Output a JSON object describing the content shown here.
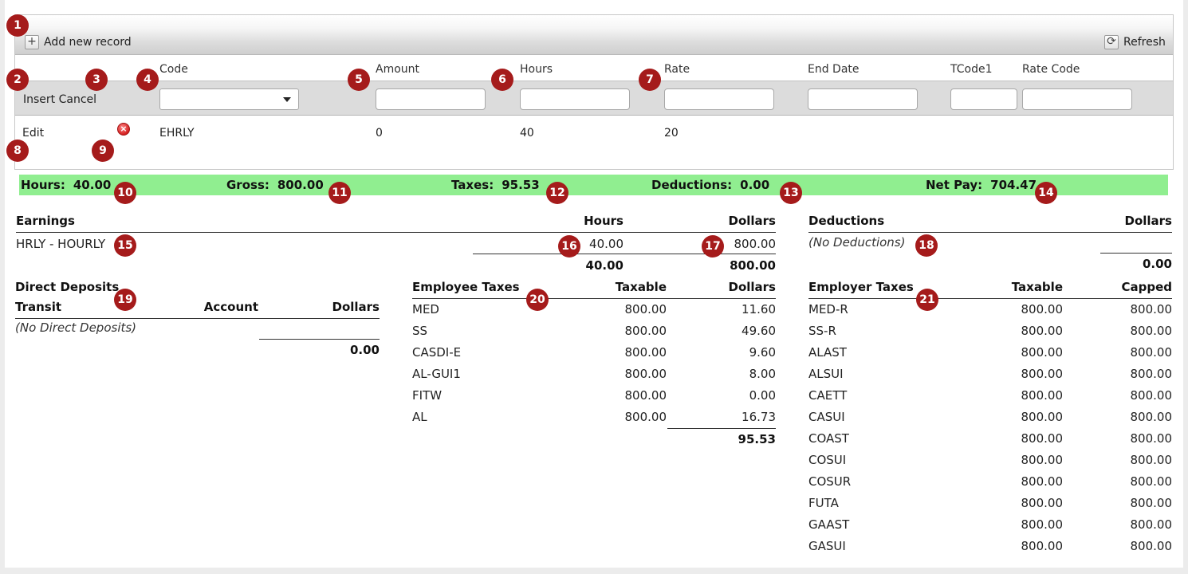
{
  "toolbar": {
    "add_label": "Add new record",
    "refresh_label": "Refresh",
    "add_glyph": "+",
    "refresh_glyph": "⟳"
  },
  "grid": {
    "columns": {
      "code": "Code",
      "amount": "Amount",
      "hours": "Hours",
      "rate": "Rate",
      "end_date": "End Date",
      "tcode1": "TCode1",
      "rate_code": "Rate Code"
    },
    "insert_label": "Insert",
    "cancel_label": "Cancel",
    "inputs": {
      "code": "",
      "amount": "",
      "hours": "",
      "rate": "",
      "end_date": "",
      "tcode1": "",
      "rate_code": ""
    },
    "row": {
      "edit_label": "Edit",
      "code": "EHRLY",
      "amount": "0",
      "hours": "40",
      "rate": "20"
    }
  },
  "summary": {
    "hours_label": "Hours:",
    "hours": "40.00",
    "gross_label": "Gross:",
    "gross": "800.00",
    "taxes_label": "Taxes:",
    "taxes": "95.53",
    "deductions_label": "Deductions:",
    "deductions": "0.00",
    "net_label": "Net Pay:",
    "net": "704.47",
    "bar_color": "#90ee90"
  },
  "earnings": {
    "title": "Earnings",
    "hours_header": "Hours",
    "dollars_header": "Dollars",
    "rows": [
      {
        "name": "HRLY - HOURLY",
        "hours": "40.00",
        "dollars": "800.00"
      }
    ],
    "total_hours": "40.00",
    "total_dollars": "800.00"
  },
  "deductions": {
    "title": "Deductions",
    "dollars_header": "Dollars",
    "empty": "(No Deductions)",
    "total": "0.00"
  },
  "direct_deposits": {
    "title": "Direct Deposits",
    "transit_header": "Transit",
    "account_header": "Account",
    "dollars_header": "Dollars",
    "empty": "(No Direct Deposits)",
    "total": "0.00"
  },
  "employee_taxes": {
    "title": "Employee Taxes",
    "taxable_header": "Taxable",
    "dollars_header": "Dollars",
    "rows": [
      {
        "code": "MED",
        "taxable": "800.00",
        "dollars": "11.60"
      },
      {
        "code": "SS",
        "taxable": "800.00",
        "dollars": "49.60"
      },
      {
        "code": "CASDI-E",
        "taxable": "800.00",
        "dollars": "9.60"
      },
      {
        "code": "AL-GUI1",
        "taxable": "800.00",
        "dollars": "8.00"
      },
      {
        "code": "FITW",
        "taxable": "800.00",
        "dollars": "0.00"
      },
      {
        "code": "AL",
        "taxable": "800.00",
        "dollars": "16.73"
      }
    ],
    "total": "95.53"
  },
  "employer_taxes": {
    "title": "Employer Taxes",
    "taxable_header": "Taxable",
    "capped_header": "Capped",
    "rows": [
      {
        "code": "MED-R",
        "taxable": "800.00",
        "capped": "800.00"
      },
      {
        "code": "SS-R",
        "taxable": "800.00",
        "capped": "800.00"
      },
      {
        "code": "ALAST",
        "taxable": "800.00",
        "capped": "800.00"
      },
      {
        "code": "ALSUI",
        "taxable": "800.00",
        "capped": "800.00"
      },
      {
        "code": "CAETT",
        "taxable": "800.00",
        "capped": "800.00"
      },
      {
        "code": "CASUI",
        "taxable": "800.00",
        "capped": "800.00"
      },
      {
        "code": "COAST",
        "taxable": "800.00",
        "capped": "800.00"
      },
      {
        "code": "COSUI",
        "taxable": "800.00",
        "capped": "800.00"
      },
      {
        "code": "COSUR",
        "taxable": "800.00",
        "capped": "800.00"
      },
      {
        "code": "FUTA",
        "taxable": "800.00",
        "capped": "800.00"
      },
      {
        "code": "GAAST",
        "taxable": "800.00",
        "capped": "800.00"
      },
      {
        "code": "GASUI",
        "taxable": "800.00",
        "capped": "800.00"
      }
    ]
  },
  "badges": [
    "1",
    "2",
    "3",
    "4",
    "5",
    "6",
    "7",
    "8",
    "9",
    "10",
    "11",
    "12",
    "13",
    "14",
    "15",
    "16",
    "17",
    "18",
    "19",
    "20",
    "21"
  ],
  "colors": {
    "badge": "#a51b1b",
    "summary": "#90ee90"
  }
}
